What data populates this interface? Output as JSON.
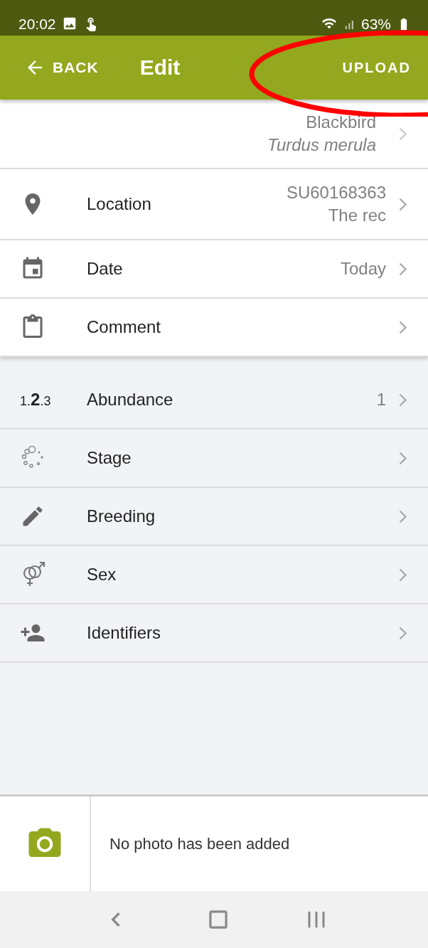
{
  "status_bar": {
    "time": "20:02",
    "battery": "63%"
  },
  "header": {
    "back": "BACK",
    "title": "Edit",
    "action": "UPLOAD"
  },
  "species": {
    "common_name": "Blackbird",
    "scientific_name": "Turdus merula"
  },
  "core_rows": [
    {
      "kind": "location",
      "label": "Location",
      "value_lines": [
        "SU60168363",
        "The rec"
      ]
    },
    {
      "kind": "date",
      "label": "Date",
      "value_lines": [
        "Today"
      ]
    },
    {
      "kind": "comment",
      "label": "Comment",
      "value_lines": []
    }
  ],
  "attribute_rows": [
    {
      "kind": "abundance",
      "icon_text": "1.**2**.3",
      "label": "Abundance",
      "value": "1"
    },
    {
      "kind": "stage",
      "label": "Stage"
    },
    {
      "kind": "breeding",
      "label": "Breeding"
    },
    {
      "kind": "sex",
      "label": "Sex"
    },
    {
      "kind": "identifiers",
      "label": "Identifiers"
    }
  ],
  "photos": {
    "message": "No photo has been added"
  }
}
